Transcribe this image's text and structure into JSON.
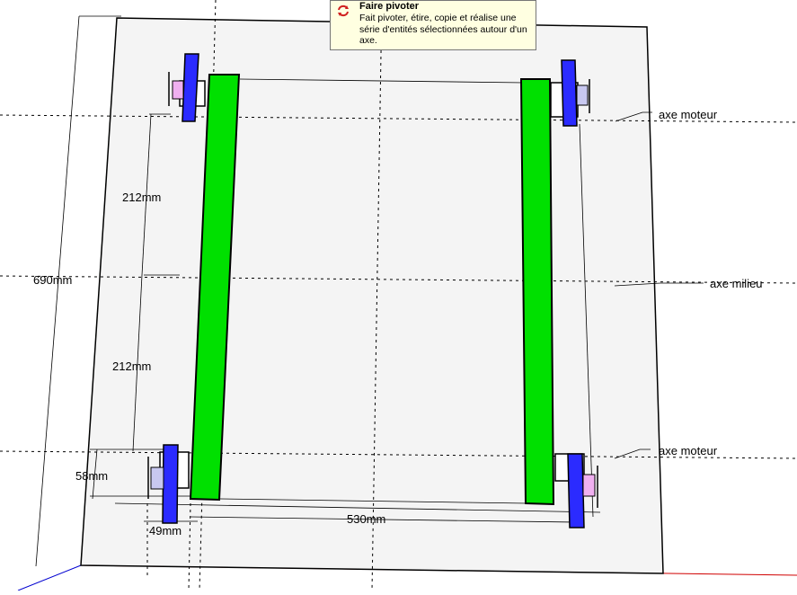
{
  "tooltip": {
    "title": "Faire pivoter",
    "description": "Fait pivoter, étire, copie et réalise une série d'entités sélectionnées autour d'un axe.",
    "icon": "rotate-icon"
  },
  "labels": {
    "axe_moteur_top": "axe moteur",
    "axe_milieu": "axe milieu",
    "axe_moteur_bottom": "axe moteur"
  },
  "dimensions": {
    "dim_212_top": "212mm",
    "dim_212_bottom": "212mm",
    "dim_690": "690mm",
    "dim_58": "58mm",
    "dim_49": "49mm",
    "dim_530": "530mm"
  },
  "colors": {
    "rail": "#00e000",
    "motor": "#2b2bff",
    "wheel_hub": "#f0b0f0",
    "wheel_hub_left": "#c8c8f0",
    "axis_red": "#d00000",
    "axis_green": "#009000",
    "axis_blue": "#0000d0"
  }
}
